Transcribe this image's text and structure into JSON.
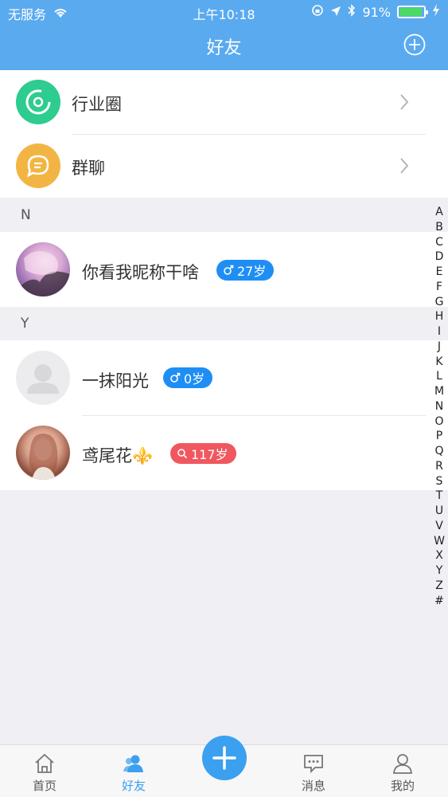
{
  "status_bar": {
    "carrier": "无服务",
    "time": "上午10:18",
    "battery": "91%"
  },
  "nav": {
    "title": "好友"
  },
  "shortcuts": [
    {
      "label": "行业圈",
      "icon": "industry-circle-icon",
      "color": "#2ecc8f"
    },
    {
      "label": "群聊",
      "icon": "group-chat-icon",
      "color": "#f2b544"
    }
  ],
  "sections": [
    {
      "letter": "N",
      "friends": [
        {
          "name": "你看我昵称干啥",
          "badge": "27岁",
          "gender": "male",
          "badge_color": "#1e8ef5"
        }
      ]
    },
    {
      "letter": "Y",
      "friends": [
        {
          "name": "一抹阳光",
          "badge": "0岁",
          "gender": "male",
          "badge_color": "#1e8ef5"
        },
        {
          "name": "鸢尾花⚜️",
          "badge": "117岁",
          "gender": "female",
          "badge_color": "#f0575f"
        }
      ]
    }
  ],
  "index_letters": [
    "A",
    "B",
    "C",
    "D",
    "E",
    "F",
    "G",
    "H",
    "I",
    "J",
    "K",
    "L",
    "M",
    "N",
    "O",
    "P",
    "Q",
    "R",
    "S",
    "T",
    "U",
    "V",
    "W",
    "X",
    "Y",
    "Z",
    "#"
  ],
  "tabbar": {
    "items": [
      {
        "label": "首页",
        "icon": "home-icon",
        "active": false
      },
      {
        "label": "好友",
        "icon": "friends-icon",
        "active": true
      },
      {
        "label": "",
        "icon": "add-icon",
        "active": false
      },
      {
        "label": "消息",
        "icon": "message-icon",
        "active": false
      },
      {
        "label": "我的",
        "icon": "profile-icon",
        "active": false
      }
    ]
  },
  "colors": {
    "header": "#5aaaf0",
    "accent": "#3aa0ef",
    "badge_blue": "#1e8ef5",
    "badge_red": "#f0575f"
  }
}
